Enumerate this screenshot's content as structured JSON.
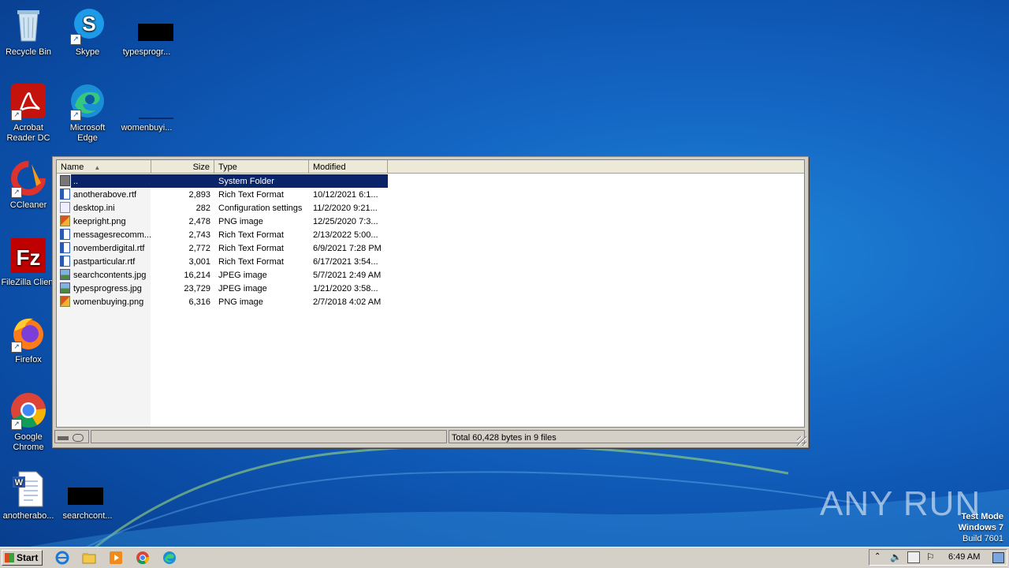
{
  "desktop": {
    "icons": [
      {
        "label": "Recycle Bin"
      },
      {
        "label": "Skype"
      },
      {
        "label": "typesprogr..."
      },
      {
        "label": "Acrobat Reader DC"
      },
      {
        "label": "Microsoft Edge"
      },
      {
        "label": "womenbuyi..."
      },
      {
        "label": "CCleaner"
      },
      {
        "label": "FileZilla Client"
      },
      {
        "label": "Firefox"
      },
      {
        "label": "Google Chrome"
      },
      {
        "label": "anotherabo..."
      },
      {
        "label": "searchcont..."
      }
    ]
  },
  "file_window": {
    "columns": {
      "name": "Name",
      "size": "Size",
      "type": "Type",
      "modified": "Modified"
    },
    "rows": [
      {
        "name": "..",
        "size": "",
        "type": "System Folder",
        "modified": ""
      },
      {
        "name": "anotherabove.rtf",
        "size": "2,893",
        "type": "Rich Text Format",
        "modified": "10/12/2021 6:1..."
      },
      {
        "name": "desktop.ini",
        "size": "282",
        "type": "Configuration settings",
        "modified": "11/2/2020 9:21..."
      },
      {
        "name": "keepright.png",
        "size": "2,478",
        "type": "PNG image",
        "modified": "12/25/2020 7:3..."
      },
      {
        "name": "messagesrecomm...",
        "size": "2,743",
        "type": "Rich Text Format",
        "modified": "2/13/2022 5:00..."
      },
      {
        "name": "novemberdigital.rtf",
        "size": "2,772",
        "type": "Rich Text Format",
        "modified": "6/9/2021 7:28 PM"
      },
      {
        "name": "pastparticular.rtf",
        "size": "3,001",
        "type": "Rich Text Format",
        "modified": "6/17/2021 3:54..."
      },
      {
        "name": "searchcontents.jpg",
        "size": "16,214",
        "type": "JPEG image",
        "modified": "5/7/2021 2:49 AM"
      },
      {
        "name": "typesprogress.jpg",
        "size": "23,729",
        "type": "JPEG image",
        "modified": "1/21/2020 3:58..."
      },
      {
        "name": "womenbuying.png",
        "size": "6,316",
        "type": "PNG image",
        "modified": "2/7/2018 4:02 AM"
      }
    ],
    "status_text": "Total 60,428 bytes in 9 files"
  },
  "taskbar": {
    "start_label": "Start",
    "clock": "6:49 AM"
  },
  "watermark": {
    "brand": "ANY RUN",
    "test_mode": "Test Mode",
    "os": "Windows 7",
    "build": "Build 7601"
  },
  "colors": {
    "desktop_blue": "#1466c4",
    "selection": "#0a246a",
    "window_face": "#d4d0c8"
  }
}
